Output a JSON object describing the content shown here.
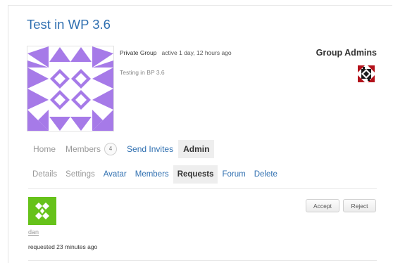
{
  "group": {
    "title": "Test in WP 3.6",
    "type": "Private Group",
    "activity": "active 1 day, 12 hours ago",
    "description": "Testing in BP 3.6",
    "admins_heading": "Group Admins"
  },
  "main_nav": {
    "home": "Home",
    "members": "Members",
    "members_count": "4",
    "send_invites": "Send Invites",
    "admin": "Admin"
  },
  "admin_nav": {
    "details": "Details",
    "settings": "Settings",
    "avatar": "Avatar",
    "members": "Members",
    "requests": "Requests",
    "forum": "Forum",
    "delete": "Delete"
  },
  "request": {
    "user": "dan",
    "time": "requested 23 minutes ago",
    "accept_label": "Accept",
    "reject_label": "Reject"
  },
  "colors": {
    "link": "#2f6fb0",
    "group_avatar": "#a67ae8",
    "user_avatar": "#66c21a"
  }
}
